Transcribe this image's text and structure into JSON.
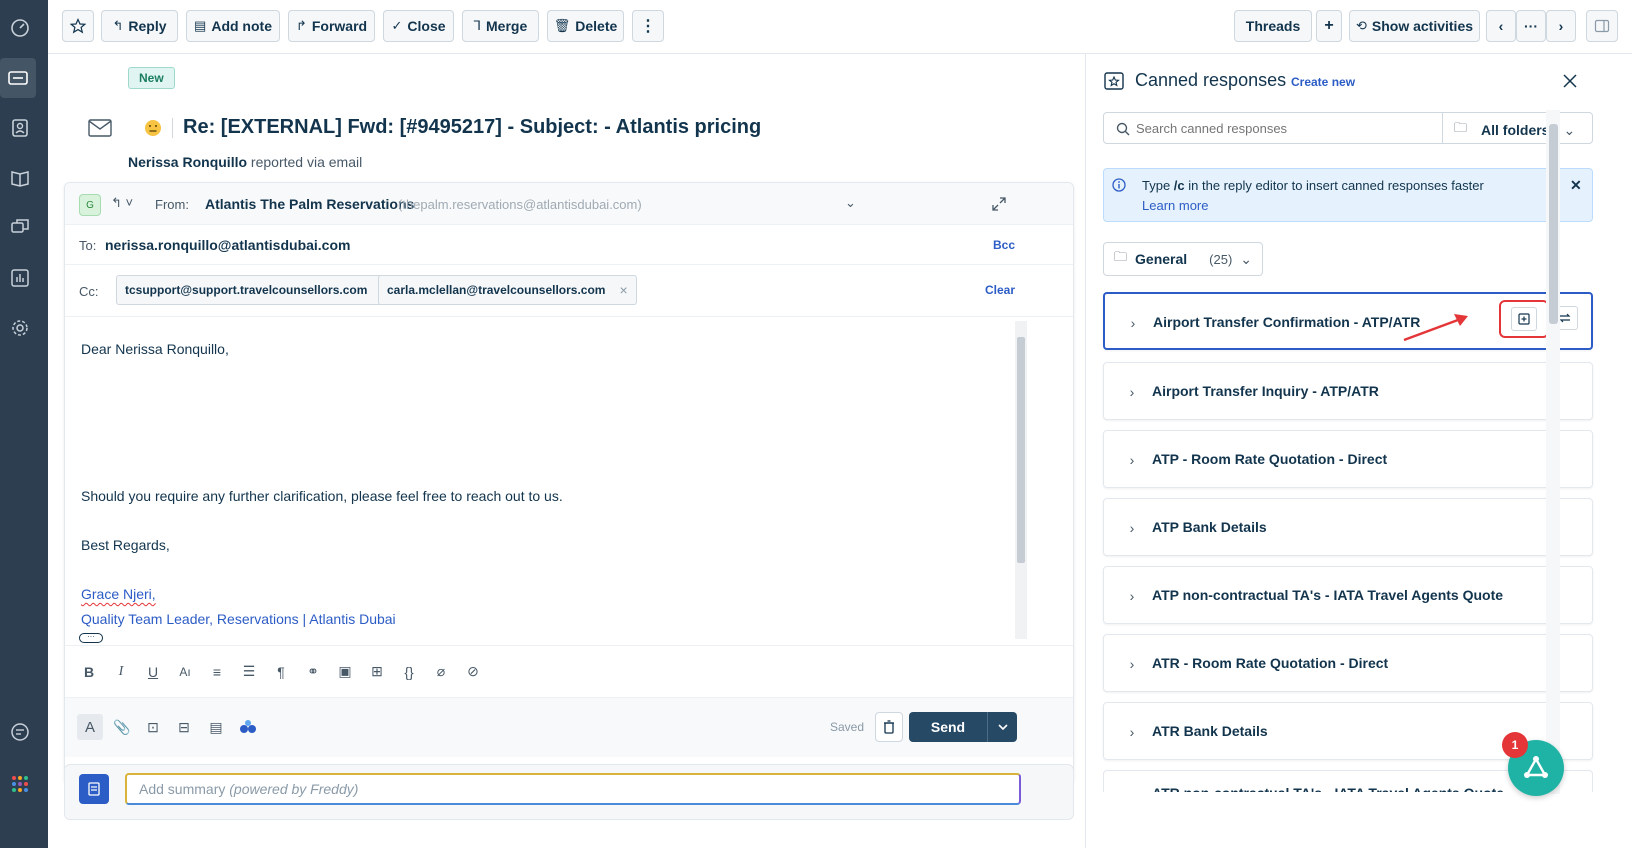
{
  "toolbar": {
    "reply": "Reply",
    "add_note": "Add note",
    "forward": "Forward",
    "close": "Close",
    "merge": "Merge",
    "delete": "Delete",
    "threads": "Threads",
    "show_activities": "Show activities",
    "more": "···"
  },
  "ticket": {
    "status_badge": "New",
    "title": "Re: [EXTERNAL] Fwd: [#9495217] - Subject: - Atlantis pricing",
    "reporter_name": "Nerissa Ronquillo",
    "reporter_suffix": "reported via email"
  },
  "reply": {
    "avatar_letter": "G",
    "from_label": "From:",
    "from_name": "Atlantis The Palm Reservations",
    "from_email": "(thepalm.reservations@atlantisdubai.com)",
    "to_label": "To:",
    "to_value": "nerissa.ronquillo@atlantisdubai.com",
    "bcc": "Bcc",
    "cc_label": "Cc:",
    "cc": [
      "tcsupport@support.travelcounsellors.com",
      "carla.mclellan@travelcounsellors.com"
    ],
    "clear": "Clear",
    "body": {
      "greeting": "Dear  Nerissa Ronquillo,",
      "line": "Should you require any further clarification, please feel free to reach out to us.",
      "regards": "Best Regards,",
      "sig_name": "Grace Njeri,",
      "sig_title": "Quality Team Leader, Reservations | Atlantis Dubai"
    },
    "saved": "Saved",
    "send": "Send",
    "summary_placeholder": "Add summary ",
    "summary_powered": "(powered by Freddy)"
  },
  "canned": {
    "title": "Canned responses",
    "create_new": "Create new",
    "search_placeholder": "Search canned responses",
    "all_folders": "All folders",
    "info_prefix": "Type ",
    "info_code": "/c",
    "info_suffix": " in the reply editor to insert canned responses faster",
    "learn_more": "Learn more",
    "folder_name": "General",
    "folder_count": "(25)",
    "items": [
      "Airport Transfer Confirmation - ATP/ATR",
      "Airport Transfer Inquiry - ATP/ATR",
      "ATP - Room Rate Quotation - Direct",
      "ATP Bank Details",
      "ATP non-contractual TA's - IATA Travel Agents Quote",
      "ATR - Room Rate Quotation - Direct",
      "ATR Bank Details",
      "ATR non-contractual TA's - IATA Travel Agents Quote"
    ]
  },
  "freddy": {
    "badge_count": "1"
  },
  "colors": {
    "accent": "#2c5cc5",
    "send_btn": "#264966",
    "nav_bg": "#2c3e50",
    "annotation_red": "#e43538"
  }
}
